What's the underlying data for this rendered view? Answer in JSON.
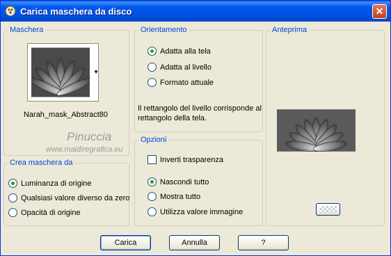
{
  "window": {
    "title": "Carica maschera da disco",
    "close_glyph": "✕"
  },
  "maschera": {
    "legend": "Maschera",
    "name": "Narah_mask_Abstract80"
  },
  "watermark": {
    "line1": "Pinuccia",
    "line2": "www.maidiregrafica.eu"
  },
  "crea": {
    "legend": "Crea maschera da",
    "options": [
      "Luminanza di origine",
      "Qualsiasi valore diverso da zero",
      "Opacità di origine"
    ],
    "selected": 0
  },
  "orientamento": {
    "legend": "Orientamento",
    "options": [
      "Adatta alla tela",
      "Adatta al livello",
      "Formato attuale"
    ],
    "selected": 0,
    "description_line1": "Il rettangolo del livello corrisponde al",
    "description_line2": "rettangolo della tela."
  },
  "opzioni": {
    "legend": "Opzioni",
    "invert_label": "Inverti trasparenza",
    "invert_checked": false,
    "options": [
      "Nascondi tutto",
      "Mostra tutto",
      "Utilizza valore immagine"
    ],
    "selected": 0
  },
  "anteprima": {
    "legend": "Anteprima"
  },
  "buttons": {
    "carica": "Carica",
    "annulla": "Annulla",
    "help": "?"
  },
  "colors": {
    "title_bar": "#0058ee",
    "legend": "#0046d5",
    "dialog_bg": "#ece9d8",
    "radio_dot": "#21a121"
  }
}
